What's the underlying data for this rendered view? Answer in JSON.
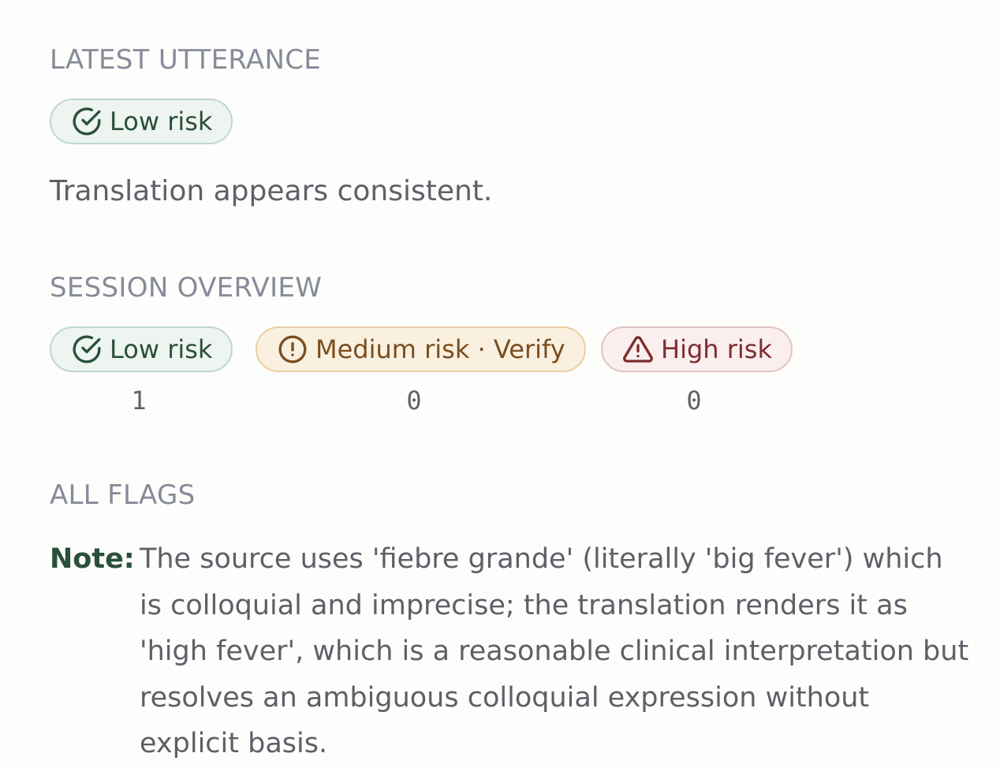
{
  "latest_utterance": {
    "section_label": "LATEST UTTERANCE",
    "risk_badge": {
      "label": "Low risk",
      "icon": "check-circle-icon"
    },
    "message": "Translation appears consistent."
  },
  "session_overview": {
    "section_label": "SESSION OVERVIEW",
    "categories": [
      {
        "label": "Low risk",
        "icon": "check-circle-icon",
        "count": "1",
        "color": "#2a4f3d"
      },
      {
        "label": "Medium risk · Verify",
        "icon": "exclamation-circle-icon",
        "count": "0",
        "color": "#7a4e20"
      },
      {
        "label": "High risk",
        "icon": "warning-triangle-icon",
        "count": "0",
        "color": "#7b2e2d"
      }
    ]
  },
  "all_flags": {
    "section_label": "ALL FLAGS",
    "flags": [
      {
        "label": "Note:",
        "text": "The source uses 'fiebre grande' (literally 'big fever') which is colloquial and imprecise; the translation renders it as 'high fever', which is a reasonable clinical interpretation but resolves an ambiguous colloquial expression without explicit basis."
      }
    ]
  }
}
